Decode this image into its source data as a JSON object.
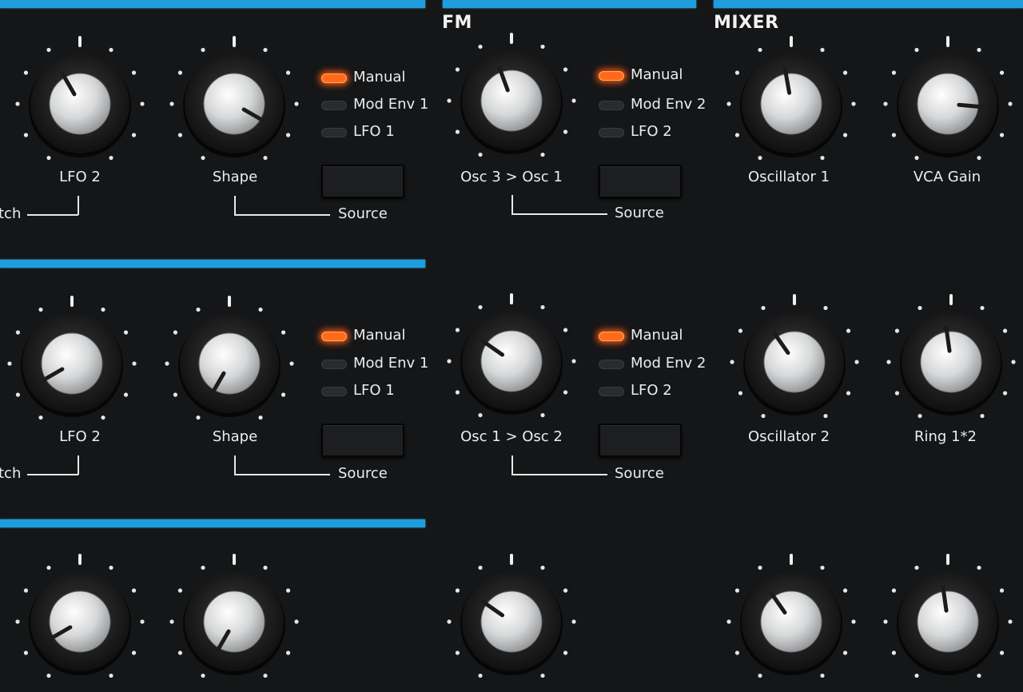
{
  "sections": {
    "fm_title": "FM",
    "mixer_title": "MIXER"
  },
  "row1": {
    "knob_lfo2": {
      "label": "LFO 2",
      "pointer_deg": -30
    },
    "knob_shape": {
      "label": "Shape",
      "pointer_deg": 120
    },
    "left_partial_label": "tch",
    "source_a": {
      "leds": [
        {
          "label": "Manual",
          "on": true
        },
        {
          "label": "Mod Env 1",
          "on": false
        },
        {
          "label": "LFO 1",
          "on": false
        }
      ],
      "source_label": "Source"
    },
    "knob_fm": {
      "label": "Osc 3 > Osc 1",
      "pointer_deg": -20
    },
    "source_b": {
      "leds": [
        {
          "label": "Manual",
          "on": true
        },
        {
          "label": "Mod Env 2",
          "on": false
        },
        {
          "label": "LFO 2",
          "on": false
        }
      ],
      "source_label": "Source"
    },
    "knob_osc1": {
      "label": "Oscillator 1",
      "pointer_deg": -10
    },
    "knob_vca": {
      "label": "VCA Gain",
      "pointer_deg": 95
    }
  },
  "row2": {
    "knob_lfo2": {
      "label": "LFO 2",
      "pointer_deg": -120
    },
    "knob_shape": {
      "label": "Shape",
      "pointer_deg": -150
    },
    "left_partial_label": "tch",
    "source_a": {
      "leds": [
        {
          "label": "Manual",
          "on": true
        },
        {
          "label": "Mod Env 1",
          "on": false
        },
        {
          "label": "LFO 1",
          "on": false
        }
      ],
      "source_label": "Source"
    },
    "knob_fm": {
      "label": "Osc 1 > Osc 2",
      "pointer_deg": -55
    },
    "source_b": {
      "leds": [
        {
          "label": "Manual",
          "on": true
        },
        {
          "label": "Mod Env 2",
          "on": false
        },
        {
          "label": "LFO 2",
          "on": false
        }
      ],
      "source_label": "Source"
    },
    "knob_osc2": {
      "label": "Oscillator 2",
      "pointer_deg": -35
    },
    "knob_ring": {
      "label": "Ring 1*2",
      "pointer_deg": -8
    }
  },
  "colors": {
    "accent_bar": "#1f9ddd",
    "led_on": "#ff6a1a",
    "panel": "#151617"
  }
}
